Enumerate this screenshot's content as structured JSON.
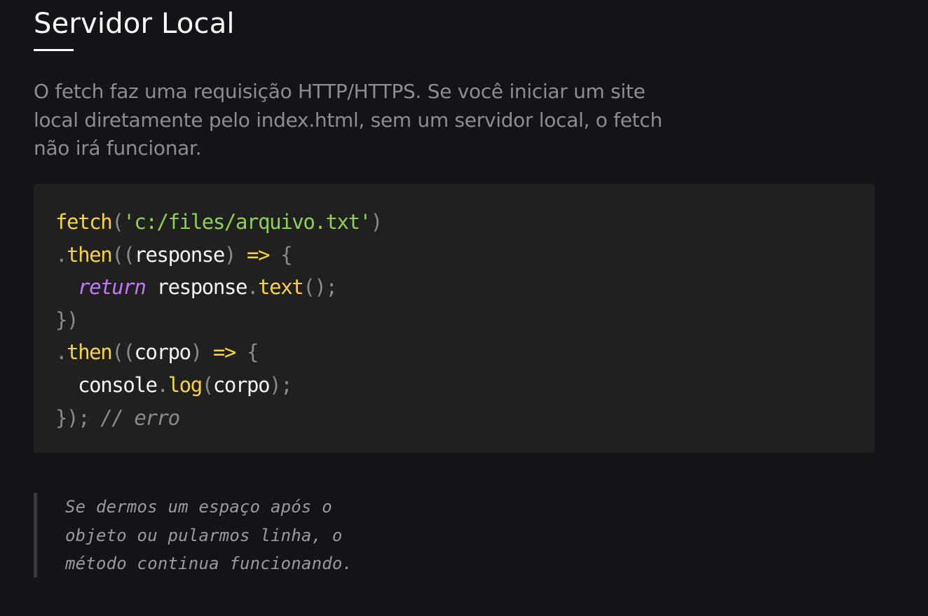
{
  "article": {
    "title": "Servidor Local",
    "intro_lines": [
      "O fetch faz uma requisição HTTP/HTTPS. Se você iniciar um site",
      "local diretamente pelo index.html, sem um servidor local, o fetch",
      "não irá funcionar."
    ]
  },
  "code_block": {
    "lines": [
      [
        {
          "t": "fetch",
          "k": "fn"
        },
        {
          "t": "(",
          "k": "punc"
        },
        {
          "t": "'c:/files/arquivo.txt'",
          "k": "str"
        },
        {
          "t": ")",
          "k": "punc"
        }
      ],
      [
        {
          "t": ".",
          "k": "punc"
        },
        {
          "t": "then",
          "k": "fn"
        },
        {
          "t": "((",
          "k": "punc"
        },
        {
          "t": "response",
          "k": "id"
        },
        {
          "t": ") ",
          "k": "punc"
        },
        {
          "t": "=>",
          "k": "arrow"
        },
        {
          "t": " {",
          "k": "punc"
        }
      ],
      [
        {
          "t": "  ",
          "k": "id"
        },
        {
          "t": "return",
          "k": "kw"
        },
        {
          "t": " response",
          "k": "id"
        },
        {
          "t": ".",
          "k": "punc"
        },
        {
          "t": "text",
          "k": "fn"
        },
        {
          "t": "();",
          "k": "punc"
        }
      ],
      [
        {
          "t": "})",
          "k": "punc"
        }
      ],
      [
        {
          "t": ".",
          "k": "punc"
        },
        {
          "t": "then",
          "k": "fn"
        },
        {
          "t": "((",
          "k": "punc"
        },
        {
          "t": "corpo",
          "k": "id"
        },
        {
          "t": ") ",
          "k": "punc"
        },
        {
          "t": "=>",
          "k": "arrow"
        },
        {
          "t": " {",
          "k": "punc"
        }
      ],
      [
        {
          "t": "  console",
          "k": "id"
        },
        {
          "t": ".",
          "k": "punc"
        },
        {
          "t": "log",
          "k": "fn"
        },
        {
          "t": "(",
          "k": "punc"
        },
        {
          "t": "corpo",
          "k": "id"
        },
        {
          "t": ");",
          "k": "punc"
        }
      ],
      [
        {
          "t": "}); ",
          "k": "punc"
        },
        {
          "t": "// erro",
          "k": "comment"
        }
      ]
    ]
  },
  "note": {
    "lines": [
      "Se dermos um espaço após o",
      "objeto ou pularmos linha, o",
      "método continua funcionando."
    ]
  },
  "colors": {
    "background": "#141317",
    "code_background": "#202021",
    "function_yellow": "#ffd43b",
    "string_green": "#8fd14f",
    "keyword_purple": "#c678ff"
  }
}
